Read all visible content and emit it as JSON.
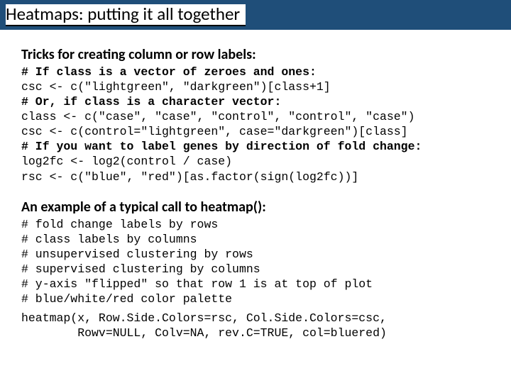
{
  "title": "Heatmaps: putting it all together",
  "section1": {
    "heading": "Tricks for creating column or row labels:",
    "c1": "# If class is a vector of zeroes and ones:",
    "l1": "csc <- c(\"lightgreen\", \"darkgreen\")[class+1]",
    "c2": "# Or, if class is a character vector:",
    "l2": "class <- c(\"case\", \"case\", \"control\", \"control\", \"case\")",
    "l3": "csc <- c(control=\"lightgreen\", case=\"darkgreen\")[class]",
    "c3": "# If you want to label genes by direction of fold change:",
    "l4": "log2fc <- log2(control / case)",
    "l5": "rsc <- c(\"blue\", \"red\")[as.factor(sign(log2fc))]"
  },
  "section2": {
    "heading": "An example of a typical call to heatmap():",
    "c1": "# fold change labels by rows",
    "c2": "# class labels by columns",
    "c3": "# unsupervised clustering by rows",
    "c4": "# supervised clustering by columns",
    "c5": "# y-axis \"flipped\" so that row 1 is at top of plot",
    "c6": "# blue/white/red color palette",
    "l1": "heatmap(x, Row.Side.Colors=rsc, Col.Side.Colors=csc,",
    "l2": "        Rowv=NULL, Colv=NA, rev.C=TRUE, col=bluered)"
  }
}
